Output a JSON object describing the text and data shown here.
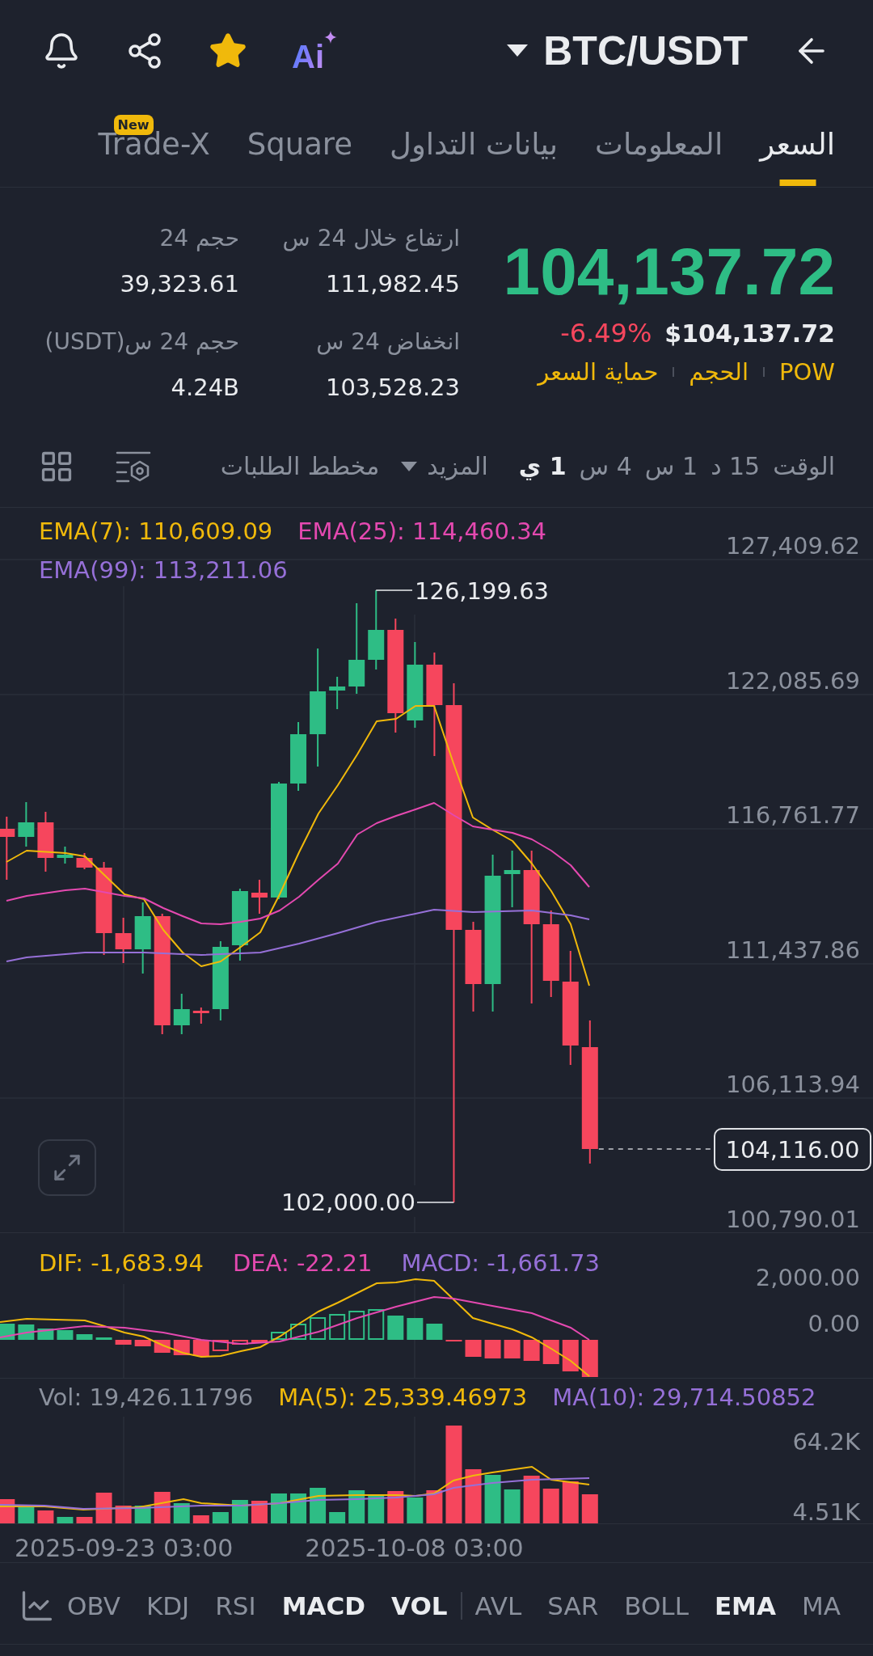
{
  "header": {
    "favorited": true,
    "ai_label": "Ai",
    "pair": "BTC/USDT"
  },
  "tabs": [
    {
      "label": "السعر",
      "selected": true
    },
    {
      "label": "المعلومات",
      "selected": false
    },
    {
      "label": "بيانات التداول",
      "selected": false
    },
    {
      "label": "Square",
      "selected": false
    },
    {
      "label": "Trade-X",
      "selected": false,
      "badge": "New"
    }
  ],
  "ticker": {
    "price": "104,137.72",
    "change": "-6.49%",
    "price_usd": "$104,137.72",
    "tags": [
      "POW",
      "الحجم",
      "حماية السعر"
    ],
    "stat_columns": [
      {
        "items": [
          {
            "label": "ارتفاع خلال 24 س",
            "value": "111,982.45"
          },
          {
            "label": "انخفاض 24 س",
            "value": "103,528.23"
          }
        ]
      },
      {
        "items": [
          {
            "label": "حجم 24",
            "value": "39,323.61"
          },
          {
            "label": "حجم 24 س(USDT)",
            "value": "4.24B"
          }
        ]
      }
    ]
  },
  "toolbar": {
    "intervals": [
      {
        "label": "الوقت",
        "selected": false
      },
      {
        "label": "15 د",
        "selected": false
      },
      {
        "label": "1 س",
        "selected": false
      },
      {
        "label": "4 س",
        "selected": false
      },
      {
        "label": "1 ي",
        "selected": true
      }
    ],
    "more": "المزيد",
    "depth_chart": "مخطط الطلبات"
  },
  "price_chart": {
    "legend": [
      {
        "label": "EMA(7): 110,609.09",
        "color": "#f0b90b"
      },
      {
        "label": "EMA(25): 114,460.34",
        "color": "#e449b0"
      },
      {
        "label": "EMA(99): 113,211.06",
        "color": "#9670d8"
      }
    ],
    "price_scale": [
      "127,409.62",
      "122,085.69",
      "116,761.77",
      "111,437.86",
      "106,113.94",
      "100,790.01"
    ],
    "high_label": "126,199.63",
    "low_label": "102,000.00",
    "last_price": "104,116.00"
  },
  "macd_chart": {
    "legend": [
      {
        "label": "DIF: -1,683.94",
        "color": "#f0b90b"
      },
      {
        "label": "DEA: -22.21",
        "color": "#e449b0"
      },
      {
        "label": "MACD: -1,661.73",
        "color": "#9670d8"
      }
    ],
    "scale": [
      "2,000.00",
      "0.00"
    ]
  },
  "volume_chart": {
    "legend": [
      {
        "label": "Vol: 19,426.11796",
        "color": "#8b919d"
      },
      {
        "label": "MA(5): 25,339.46973",
        "color": "#f0b90b"
      },
      {
        "label": "MA(10): 29,714.50852",
        "color": "#9670d8"
      }
    ],
    "scale": [
      "64.2K",
      "4.51K"
    ]
  },
  "time_axis": [
    "2025-09-23 03:00",
    "2025-10-08 03:00"
  ],
  "indicators": [
    {
      "items": [
        {
          "label": "OBV",
          "selected": false
        },
        {
          "label": "KDJ",
          "selected": false
        },
        {
          "label": "RSI",
          "selected": false
        },
        {
          "label": "MACD",
          "selected": true
        },
        {
          "label": "VOL",
          "selected": true
        }
      ]
    },
    {
      "items": [
        {
          "label": "AVL",
          "selected": false
        },
        {
          "label": "SAR",
          "selected": false
        },
        {
          "label": "BOLL",
          "selected": false
        },
        {
          "label": "EMA",
          "selected": true
        },
        {
          "label": "MA",
          "selected": false
        }
      ]
    }
  ]
}
